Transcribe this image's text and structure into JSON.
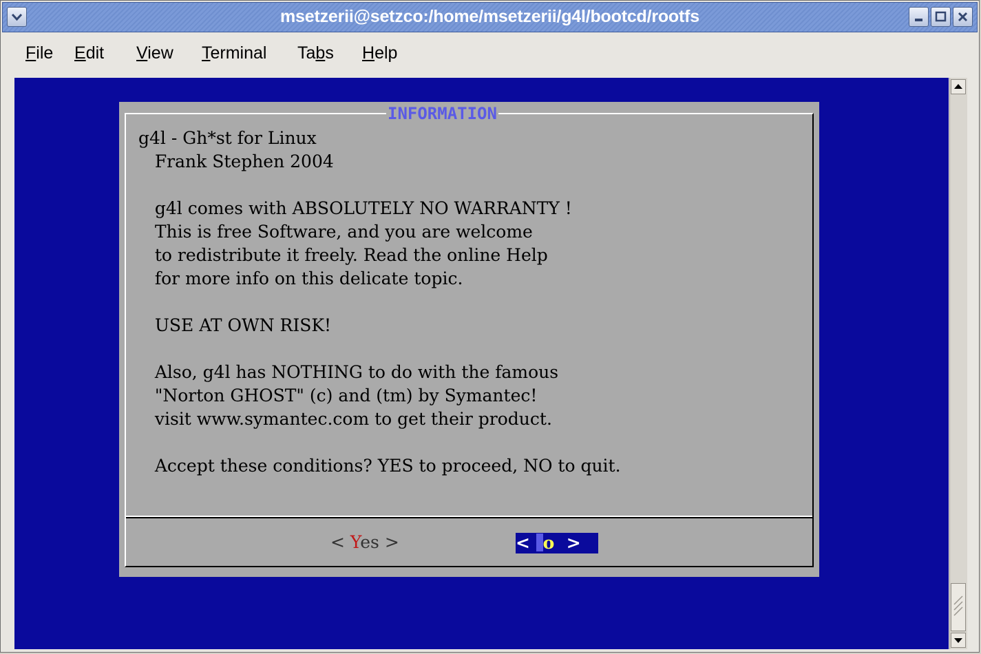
{
  "window": {
    "title": "msetzerii@setzco:/home/msetzerii/g4l/bootcd/rootfs"
  },
  "menubar": {
    "items": [
      {
        "pre": "",
        "hot": "F",
        "post": "ile"
      },
      {
        "pre": "",
        "hot": "E",
        "post": "dit"
      },
      {
        "pre": "",
        "hot": "V",
        "post": "iew"
      },
      {
        "pre": "",
        "hot": "T",
        "post": "erminal"
      },
      {
        "pre": "Ta",
        "hot": "b",
        "post": "s"
      },
      {
        "pre": "",
        "hot": "H",
        "post": "elp"
      }
    ]
  },
  "dialog": {
    "title": "INFORMATION",
    "lines": [
      "g4l - Gh*st for Linux",
      "   Frank Stephen 2004",
      "",
      "   g4l comes with ABSOLUTELY NO WARRANTY !",
      "   This is free Software, and you are welcome",
      "   to redistribute it freely. Read the online Help",
      "   for more info on this delicate topic.",
      "",
      "   USE AT OWN RISK!",
      "",
      "   Also, g4l has NOTHING to do with the famous",
      "   \"Norton GHOST\" (c) and (tm) by Symantec!",
      "   visit www.symantec.com to get their product.",
      "",
      "   Accept these conditions? YES to proceed, NO to quit."
    ],
    "yes_button": {
      "left": "< ",
      "hot": "Y",
      "rest": "es >"
    },
    "no_button": {
      "left": "< ",
      "hot": "o",
      "right": "  >"
    }
  },
  "colors": {
    "terminal_bg": "#0a0a9c",
    "dialog_bg": "#aaaaaa",
    "title_text": "#5a5ae6",
    "hotkey_red": "#c11818",
    "hotkey_yellow": "#ffff55"
  }
}
